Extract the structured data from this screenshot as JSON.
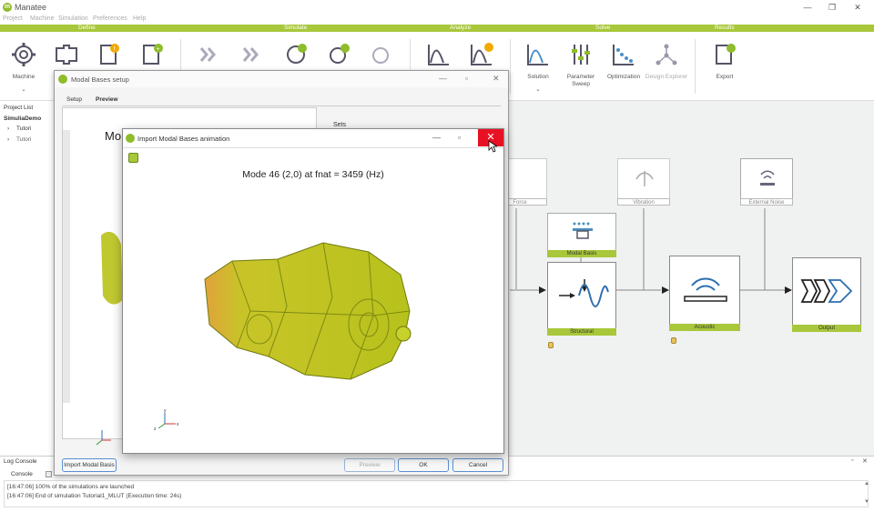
{
  "app": {
    "title": "Manatee",
    "logo_letter": "m"
  },
  "menu": [
    "Project",
    "Machine",
    "Simulation",
    "Preferences",
    "Help"
  ],
  "ribbon_groups": [
    "Define",
    "Simulate",
    "Analyze",
    "Solve",
    "Results"
  ],
  "ribbon": {
    "machine": "Machine",
    "solution": "Solution",
    "parameter_sweep": "Parameter Sweep",
    "optimization": "Optimization",
    "design_explorer": "Design Explorer",
    "export": "Export"
  },
  "project_list": {
    "header": "Project List",
    "root": "SimuliaDemo",
    "items": [
      "Tutori",
      "Tutori"
    ]
  },
  "workflow": {
    "nodes": {
      "force": "Force",
      "vibration": "Vibration",
      "external_noise": "External Noise",
      "modal_basis": "Modal Basis",
      "structural": "Structural",
      "acoustic": "Acoustic",
      "output": "Output"
    }
  },
  "log_console": {
    "header": "Log Console",
    "tab": "Console",
    "lines": [
      "[16:47:06] 100% of the simulations are launched",
      "[16:47:06] End of simulation Tutorial1_MLUT (Execution time: 24s)"
    ]
  },
  "modal_setup": {
    "title": "Modal Bases setup",
    "tabs": [
      "Setup",
      "Preview"
    ],
    "sets_label": "Sets",
    "preview_heading": "Mo",
    "import_button": "Import Modal Basis",
    "preview_button": "Preview",
    "ok_button": "OK",
    "cancel_button": "Cancel"
  },
  "import_anim": {
    "title": "Import Modal Bases animation",
    "mode_title": "Mode 46 (2,0) at fnat = 3459 (Hz)",
    "axes": {
      "x": "x",
      "y": "y",
      "z": "z"
    }
  },
  "colors": {
    "accent": "#a8c73a",
    "close": "#e81123",
    "mesh": "#c6d12a"
  }
}
